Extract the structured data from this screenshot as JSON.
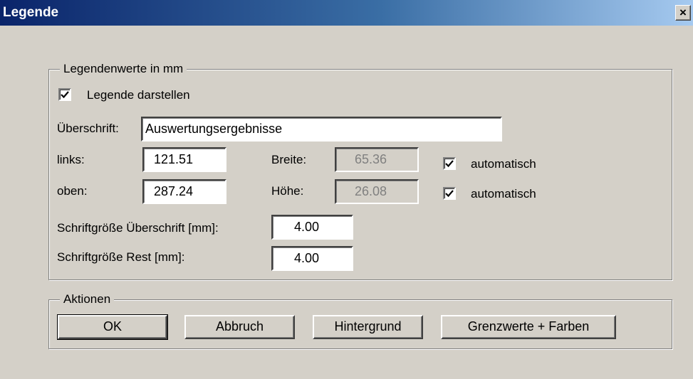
{
  "window": {
    "title": "Legende",
    "close_symbol": "×"
  },
  "group_values": {
    "legend": "Legendenwerte in mm",
    "show_legend": {
      "label": "Legende darstellen",
      "checked": true
    },
    "heading_label": "Überschrift:",
    "heading_value": "Auswertungsergebnisse",
    "left_label": "links:",
    "left_value": "121.51",
    "top_label": "oben:",
    "top_value": "287.24",
    "width_label": "Breite:",
    "width_value": "65.36",
    "height_label": "Höhe:",
    "height_value": "26.08",
    "auto_width": {
      "label": "automatisch",
      "checked": true
    },
    "auto_height": {
      "label": "automatisch",
      "checked": true
    },
    "font_heading_label": "Schriftgröße Überschrift [mm]:",
    "font_heading_value": "4.00",
    "font_rest_label": "Schriftgröße Rest [mm]:",
    "font_rest_value": "4.00"
  },
  "group_actions": {
    "legend": "Aktionen",
    "ok": "OK",
    "cancel": "Abbruch",
    "background": "Hintergrund",
    "limits_colors": "Grenzwerte + Farben"
  }
}
